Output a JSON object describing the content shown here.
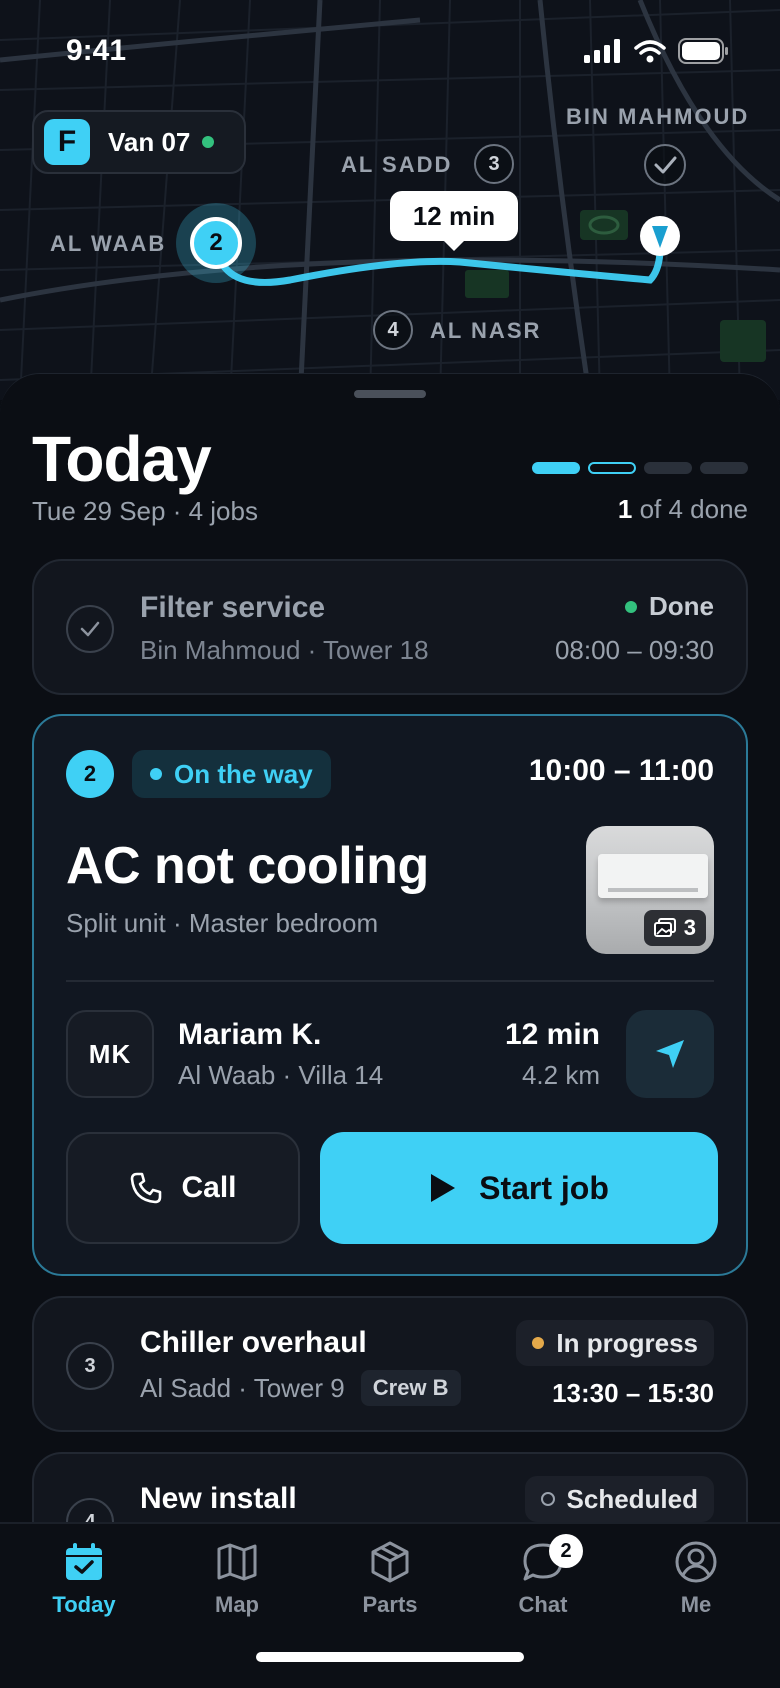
{
  "status_bar": {
    "time": "9:41"
  },
  "map": {
    "vehicle": {
      "logo_letter": "F",
      "name": "Van 07"
    },
    "labels": {
      "al_waab": "AL WAAB",
      "al_sadd": "AL SADD",
      "bin_mahmoud": "BIN MAHMOUD",
      "al_nasr": "AL NASR"
    },
    "stops": {
      "current": "2",
      "al_sadd": "3",
      "al_nasr": "4"
    },
    "route_eta": "12 min"
  },
  "header": {
    "title": "Today",
    "subtitle": "Tue 29 Sep · 4 jobs",
    "progress": {
      "done": "1",
      "rest": " of 4 done",
      "segments": [
        "done",
        "active",
        "todo",
        "todo"
      ]
    }
  },
  "jobs": {
    "completed": {
      "title": "Filter service",
      "location": "Bin Mahmoud · Tower 18",
      "status": "Done",
      "time": "08:00 – 09:30"
    },
    "current": {
      "number": "2",
      "status": "On the way",
      "time": "10:00 – 11:00",
      "title": "AC not cooling",
      "location": "Split unit · Master bedroom",
      "photo_count": "3",
      "customer": {
        "initials": "MK",
        "name": "Mariam K.",
        "address": "Al Waab · Villa 14"
      },
      "eta": {
        "time": "12 min",
        "distance": "4.2 km"
      },
      "call_label": "Call",
      "start_label": "Start job"
    },
    "third": {
      "number": "3",
      "title": "Chiller overhaul",
      "location": "Al Sadd · Tower 9",
      "crew": "Crew B",
      "status": "In progress",
      "time": "13:30 – 15:30"
    },
    "fourth": {
      "number": "4",
      "title": "New install",
      "status": "Scheduled"
    }
  },
  "tabs": {
    "today": "Today",
    "map": "Map",
    "parts": "Parts",
    "chat": "Chat",
    "chat_badge": "2",
    "me": "Me"
  },
  "colors": {
    "accent": "#3fd0f5",
    "done": "#33c17e",
    "in_progress": "#e4a94a",
    "background": "#0b0e14"
  }
}
